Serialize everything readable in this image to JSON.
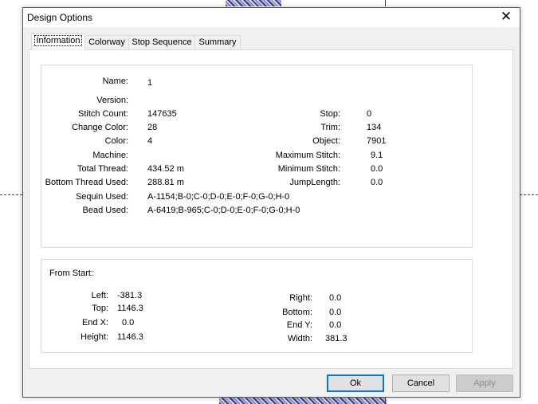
{
  "dialog": {
    "title": "Design Options",
    "close_glyph": "✕"
  },
  "tabs": [
    {
      "label": "Information",
      "active": true
    },
    {
      "label": "Colorway",
      "active": false
    },
    {
      "label": "Stop Sequence",
      "active": false
    },
    {
      "label": "Summary",
      "active": false
    }
  ],
  "info": {
    "name": {
      "label": "Name:",
      "value": "1"
    },
    "version": {
      "label": "Version:",
      "value": ""
    },
    "stitch_count": {
      "label": "Stitch Count:",
      "value": "147635"
    },
    "change_color": {
      "label": "Change Color:",
      "value": "28"
    },
    "color": {
      "label": "Color:",
      "value": "4"
    },
    "machine": {
      "label": "Machine:",
      "value": ""
    },
    "total_thread": {
      "label": "Total Thread:",
      "value": "434.52 m"
    },
    "bottom_thread": {
      "label": "Bottom Thread Used:",
      "value": "288.81 m"
    },
    "sequin_used": {
      "label": "Sequin Used:",
      "value": "A-1154;B-0;C-0;D-0;E-0;F-0;G-0;H-0"
    },
    "bead_used": {
      "label": "Bead Used:",
      "value": "A-6419;B-965;C-0;D-0;E-0;F-0;G-0;H-0"
    },
    "stop": {
      "label": "Stop:",
      "value": "0"
    },
    "trim": {
      "label": "Trim:",
      "value": "134"
    },
    "object": {
      "label": "Object:",
      "value": "7901"
    },
    "max_stitch": {
      "label": "Maximum Stitch:",
      "value": "9.1"
    },
    "min_stitch": {
      "label": "Minimum Stitch:",
      "value": "0.0"
    },
    "jump_length": {
      "label": "JumpLength:",
      "value": "0.0"
    }
  },
  "from_start": {
    "heading": "From Start:",
    "left": {
      "label": "Left:",
      "value": "-381.3"
    },
    "top": {
      "label": "Top:",
      "value": "1146.3"
    },
    "end_x": {
      "label": "End X:",
      "value": "0.0"
    },
    "height": {
      "label": "Height:",
      "value": "1146.3"
    },
    "right": {
      "label": "Right:",
      "value": "0.0"
    },
    "bottom": {
      "label": "Bottom:",
      "value": "0.0"
    },
    "end_y": {
      "label": "End Y:",
      "value": "0.0"
    },
    "width": {
      "label": "Width:",
      "value": "381.3"
    }
  },
  "buttons": {
    "ok": "Ok",
    "cancel": "Cancel",
    "apply": "Apply"
  }
}
